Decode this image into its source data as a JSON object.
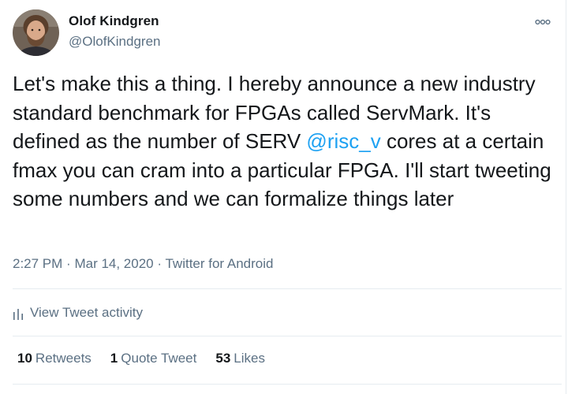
{
  "author": {
    "name": "Olof Kindgren",
    "handle": "@OlofKindgren"
  },
  "tweet": {
    "text_part1": "Let's make this a thing. I hereby announce a new industry standard benchmark for FPGAs called ServMark. It's defined as the number of SERV ",
    "mention": "@risc_v",
    "text_part2": " cores at a certain fmax you can cram into a particular FPGA. I'll start tweeting some numbers and we can formalize things later"
  },
  "meta": {
    "time": "2:27 PM",
    "date": "Mar 14, 2020",
    "source": "Twitter for Android",
    "separator": "·"
  },
  "activity": {
    "label": "View Tweet activity",
    "icon": "bar-chart-icon"
  },
  "stats": {
    "retweets_count": "10",
    "retweets_label": "Retweets",
    "quote_count": "1",
    "quote_label": "Quote Tweet",
    "likes_count": "53",
    "likes_label": "Likes"
  },
  "colors": {
    "accent": "#1da1f2",
    "secondary_text": "#5b7083",
    "divider": "#e6ecf0"
  },
  "icons": {
    "more": "more-options-icon"
  }
}
